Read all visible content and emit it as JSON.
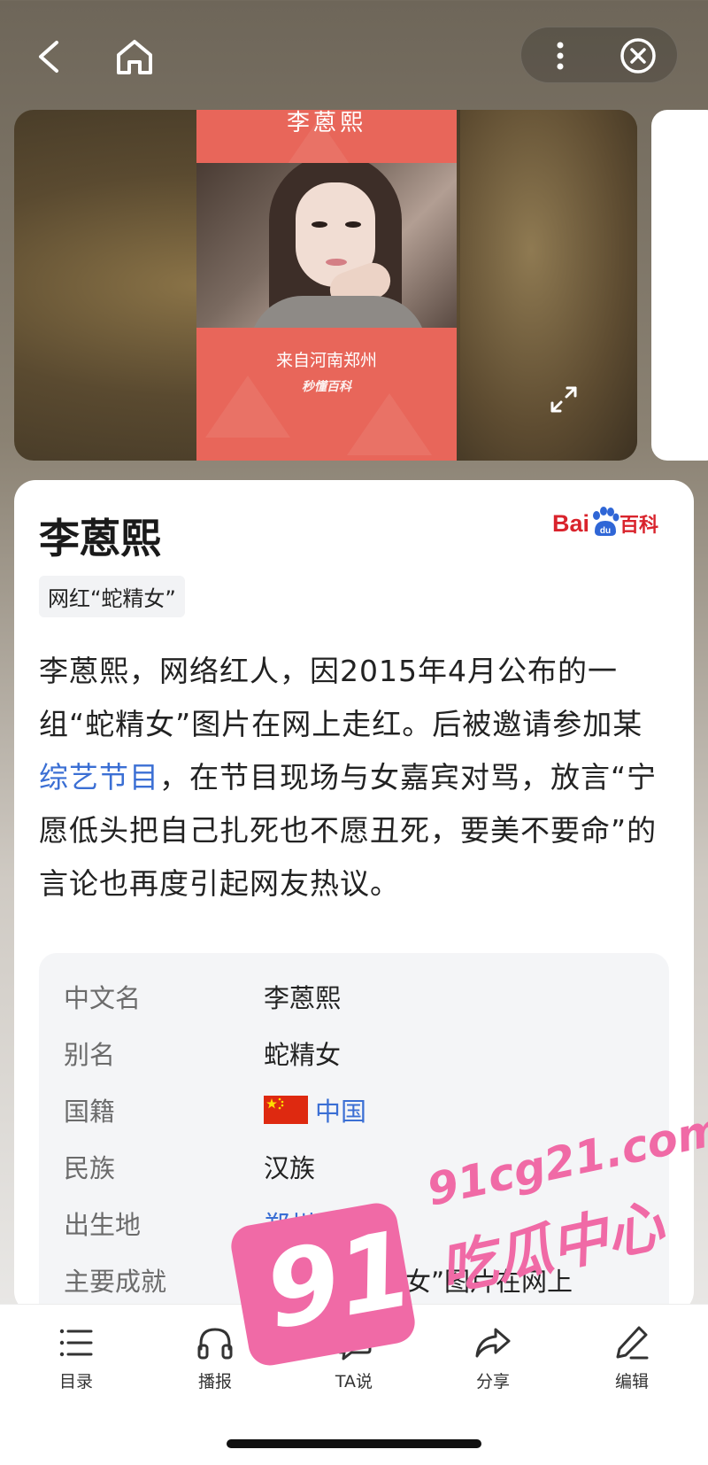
{
  "hero": {
    "poster_title": "李蒽熙",
    "poster_subtitle": "来自河南郑州",
    "poster_brand": "秒懂百科"
  },
  "card": {
    "title": "李蒽熙",
    "source_logo": "Baidu百科",
    "tag": "网红“蛇精女”",
    "intro_part1": "李蒽熙，网络红人，因2015年4月公布的一组“蛇精女”图片在网上走红。后被邀请参加某",
    "intro_link": "综艺节目",
    "intro_part2": "，在节目现场与女嘉宾对骂，放言“宁愿低头把自己扎死也不愿丑死，要美不要命”的言论也再度引起网友热议。"
  },
  "info": [
    {
      "label": "中文名",
      "value": "李蒽熙"
    },
    {
      "label": "别名",
      "value": "蛇精女"
    },
    {
      "label": "国籍",
      "value": "中国"
    },
    {
      "label": "民族",
      "value": "汉族"
    },
    {
      "label": "出生地",
      "value": "郑州"
    },
    {
      "label": "主要成就",
      "value": "因一组“蛇精女”图片在网上"
    }
  ],
  "toolbar": {
    "items": [
      {
        "label": "目录",
        "icon": "list-icon"
      },
      {
        "label": "播报",
        "icon": "headphones-icon"
      },
      {
        "label": "TA说",
        "icon": "comment-icon"
      },
      {
        "label": "分享",
        "icon": "share-icon"
      },
      {
        "label": "编辑",
        "icon": "pencil-icon"
      }
    ]
  },
  "watermark": {
    "number": "91",
    "url": "91cg21.com",
    "text": "吃瓜中心"
  },
  "colors": {
    "link": "#3b6fd4",
    "brand_red": "#d9232c",
    "watermark_pink": "#f06aa6",
    "poster_red": "#e8665a"
  }
}
